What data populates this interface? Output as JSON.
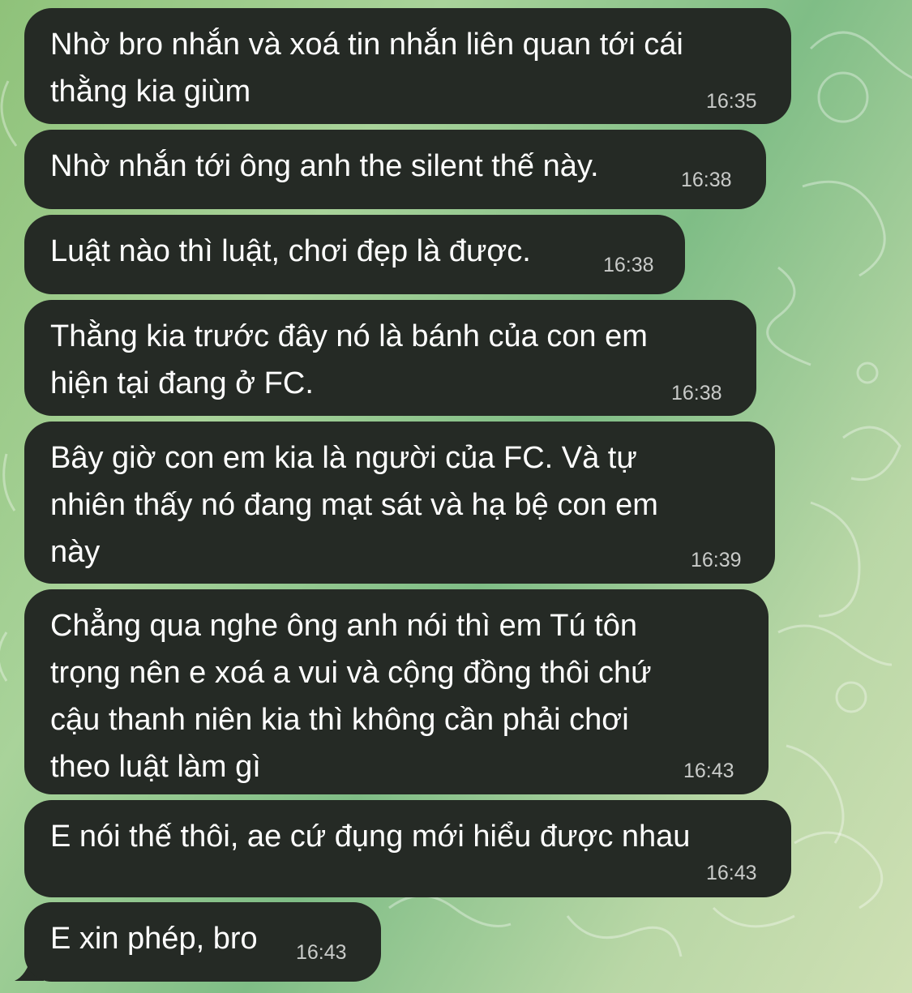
{
  "chat": {
    "messages": [
      {
        "text": "Nhờ bro nhắn và xoá tin nhắn liên quan tới cái\nthằng kia giùm",
        "time": "16:35"
      },
      {
        "text": "Nhờ nhắn tới ông anh the silent thế này.",
        "time": "16:38"
      },
      {
        "text": "Luật nào thì luật, chơi đẹp là được.",
        "time": "16:38"
      },
      {
        "text": "Thằng kia trước đây nó là bánh của con em\nhiện tại đang ở FC.",
        "time": "16:38"
      },
      {
        "text": "Bây giờ con em kia là người của FC. Và tự\nnhiên thấy nó đang mạt sát và hạ bệ con em\nnày",
        "time": "16:39"
      },
      {
        "text": "Chẳng qua nghe ông anh nói thì em Tú tôn\ntrọng nên e xoá a vui và cộng đồng thôi chứ\ncậu thanh niên kia thì không cần phải chơi\ntheo luật làm gì",
        "time": "16:43"
      },
      {
        "text": "E nói thế thôi, ae cứ đụng mới hiểu được nhau",
        "time": "16:43"
      },
      {
        "text": "E xin phép, bro",
        "time": "16:43"
      }
    ]
  },
  "colors": {
    "bubble": "#252a25",
    "text": "#ffffff",
    "time": "#c9cbc9",
    "wallpaper": "#a9d39a"
  }
}
